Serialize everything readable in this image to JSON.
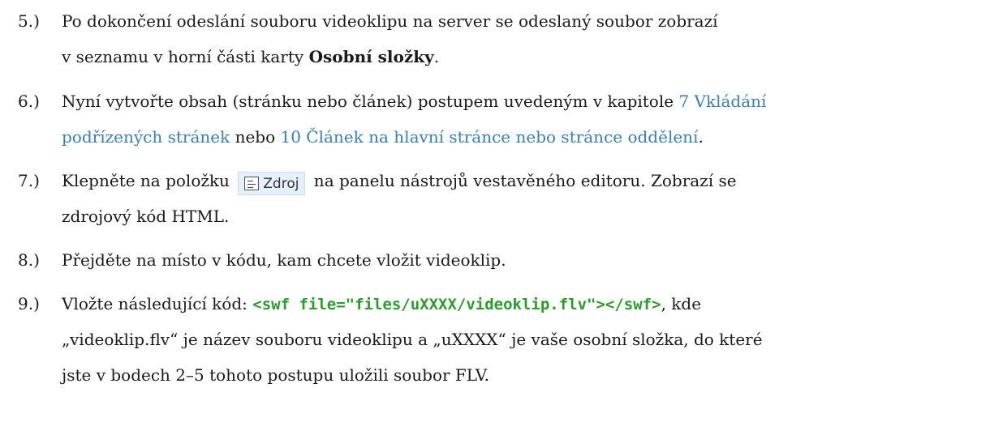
{
  "steps": [
    {
      "num": "5.)",
      "l1": "Po dokončení odeslání souboru videoklipu na server se odeslaný soubor zobrazí",
      "l2_pre": "v seznamu v horní části karty ",
      "l2_bold": "Osobní složky",
      "l2_post": "."
    },
    {
      "num": "6.)",
      "l1_pre": "Nyní vytvořte obsah (stránku nebo článek) postupem uvedeným v kapitole ",
      "l1_link": "7  Vkládání",
      "l2_link1": "podřízených stránek",
      "l2_mid": " nebo ",
      "l2_link2": "10  Článek na hlavní stránce nebo stránce oddělení",
      "l2_post": "."
    },
    {
      "num": "7.)",
      "l1_pre": "Klepněte na položku ",
      "button_label": "Zdroj",
      "l1_post": " na panelu nástrojů vestavěného editoru. Zobrazí se",
      "l2": "zdrojový kód HTML."
    },
    {
      "num": "8.)",
      "l1": "Přejděte na místo v kódu, kam chcete vložit videoklip."
    },
    {
      "num": "9.)",
      "l1_pre": "Vložte následující kód: ",
      "l1_code": "<swf file=\"files/uXXXX/videoklip.flv\"></swf>",
      "l1_post": ", kde",
      "l2": "„videoklip.flv“ je název souboru videoklipu a „uXXXX“ je vaše osobní složka, do které",
      "l3": "jste v bodech 2–5 tohoto postupu uložili soubor FLV."
    }
  ]
}
